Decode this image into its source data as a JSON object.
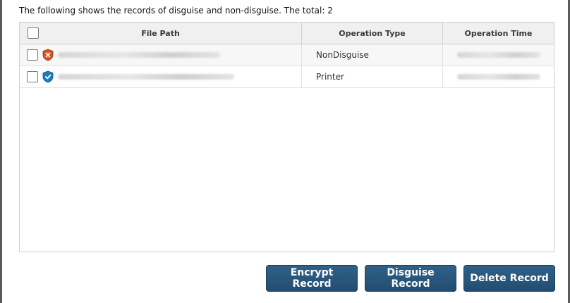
{
  "summary_text": "The following shows the records of disguise and non-disguise. The total: 2",
  "table": {
    "headers": [
      "File Path",
      "Operation Type",
      "Operation Time"
    ],
    "rows": [
      {
        "icon": "shield-x-icon",
        "icon_color": "#d9541e",
        "operation_type": "NonDisguise"
      },
      {
        "icon": "shield-check-icon",
        "icon_color": "#1a7fc0",
        "operation_type": "Printer"
      }
    ]
  },
  "buttons": {
    "encrypt": "Encrypt Record",
    "disguise": "Disguise Record",
    "delete": "Delete Record"
  },
  "colors": {
    "button_bg": "#2a5a80",
    "header_bg": "#f0f0f0"
  }
}
